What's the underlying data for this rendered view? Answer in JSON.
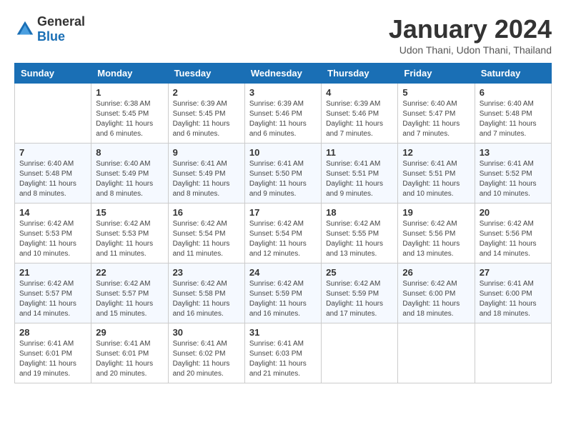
{
  "header": {
    "logo_general": "General",
    "logo_blue": "Blue",
    "month_title": "January 2024",
    "location": "Udon Thani, Udon Thani, Thailand"
  },
  "days_of_week": [
    "Sunday",
    "Monday",
    "Tuesday",
    "Wednesday",
    "Thursday",
    "Friday",
    "Saturday"
  ],
  "weeks": [
    [
      {
        "day": "",
        "content": ""
      },
      {
        "day": "1",
        "content": "Sunrise: 6:38 AM\nSunset: 5:45 PM\nDaylight: 11 hours and 6 minutes."
      },
      {
        "day": "2",
        "content": "Sunrise: 6:39 AM\nSunset: 5:45 PM\nDaylight: 11 hours and 6 minutes."
      },
      {
        "day": "3",
        "content": "Sunrise: 6:39 AM\nSunset: 5:46 PM\nDaylight: 11 hours and 6 minutes."
      },
      {
        "day": "4",
        "content": "Sunrise: 6:39 AM\nSunset: 5:46 PM\nDaylight: 11 hours and 7 minutes."
      },
      {
        "day": "5",
        "content": "Sunrise: 6:40 AM\nSunset: 5:47 PM\nDaylight: 11 hours and 7 minutes."
      },
      {
        "day": "6",
        "content": "Sunrise: 6:40 AM\nSunset: 5:48 PM\nDaylight: 11 hours and 7 minutes."
      }
    ],
    [
      {
        "day": "7",
        "content": "Sunrise: 6:40 AM\nSunset: 5:48 PM\nDaylight: 11 hours and 8 minutes."
      },
      {
        "day": "8",
        "content": "Sunrise: 6:40 AM\nSunset: 5:49 PM\nDaylight: 11 hours and 8 minutes."
      },
      {
        "day": "9",
        "content": "Sunrise: 6:41 AM\nSunset: 5:49 PM\nDaylight: 11 hours and 8 minutes."
      },
      {
        "day": "10",
        "content": "Sunrise: 6:41 AM\nSunset: 5:50 PM\nDaylight: 11 hours and 9 minutes."
      },
      {
        "day": "11",
        "content": "Sunrise: 6:41 AM\nSunset: 5:51 PM\nDaylight: 11 hours and 9 minutes."
      },
      {
        "day": "12",
        "content": "Sunrise: 6:41 AM\nSunset: 5:51 PM\nDaylight: 11 hours and 10 minutes."
      },
      {
        "day": "13",
        "content": "Sunrise: 6:41 AM\nSunset: 5:52 PM\nDaylight: 11 hours and 10 minutes."
      }
    ],
    [
      {
        "day": "14",
        "content": "Sunrise: 6:42 AM\nSunset: 5:53 PM\nDaylight: 11 hours and 10 minutes."
      },
      {
        "day": "15",
        "content": "Sunrise: 6:42 AM\nSunset: 5:53 PM\nDaylight: 11 hours and 11 minutes."
      },
      {
        "day": "16",
        "content": "Sunrise: 6:42 AM\nSunset: 5:54 PM\nDaylight: 11 hours and 11 minutes."
      },
      {
        "day": "17",
        "content": "Sunrise: 6:42 AM\nSunset: 5:54 PM\nDaylight: 11 hours and 12 minutes."
      },
      {
        "day": "18",
        "content": "Sunrise: 6:42 AM\nSunset: 5:55 PM\nDaylight: 11 hours and 13 minutes."
      },
      {
        "day": "19",
        "content": "Sunrise: 6:42 AM\nSunset: 5:56 PM\nDaylight: 11 hours and 13 minutes."
      },
      {
        "day": "20",
        "content": "Sunrise: 6:42 AM\nSunset: 5:56 PM\nDaylight: 11 hours and 14 minutes."
      }
    ],
    [
      {
        "day": "21",
        "content": "Sunrise: 6:42 AM\nSunset: 5:57 PM\nDaylight: 11 hours and 14 minutes."
      },
      {
        "day": "22",
        "content": "Sunrise: 6:42 AM\nSunset: 5:57 PM\nDaylight: 11 hours and 15 minutes."
      },
      {
        "day": "23",
        "content": "Sunrise: 6:42 AM\nSunset: 5:58 PM\nDaylight: 11 hours and 16 minutes."
      },
      {
        "day": "24",
        "content": "Sunrise: 6:42 AM\nSunset: 5:59 PM\nDaylight: 11 hours and 16 minutes."
      },
      {
        "day": "25",
        "content": "Sunrise: 6:42 AM\nSunset: 5:59 PM\nDaylight: 11 hours and 17 minutes."
      },
      {
        "day": "26",
        "content": "Sunrise: 6:42 AM\nSunset: 6:00 PM\nDaylight: 11 hours and 18 minutes."
      },
      {
        "day": "27",
        "content": "Sunrise: 6:41 AM\nSunset: 6:00 PM\nDaylight: 11 hours and 18 minutes."
      }
    ],
    [
      {
        "day": "28",
        "content": "Sunrise: 6:41 AM\nSunset: 6:01 PM\nDaylight: 11 hours and 19 minutes."
      },
      {
        "day": "29",
        "content": "Sunrise: 6:41 AM\nSunset: 6:01 PM\nDaylight: 11 hours and 20 minutes."
      },
      {
        "day": "30",
        "content": "Sunrise: 6:41 AM\nSunset: 6:02 PM\nDaylight: 11 hours and 20 minutes."
      },
      {
        "day": "31",
        "content": "Sunrise: 6:41 AM\nSunset: 6:03 PM\nDaylight: 11 hours and 21 minutes."
      },
      {
        "day": "",
        "content": ""
      },
      {
        "day": "",
        "content": ""
      },
      {
        "day": "",
        "content": ""
      }
    ]
  ]
}
